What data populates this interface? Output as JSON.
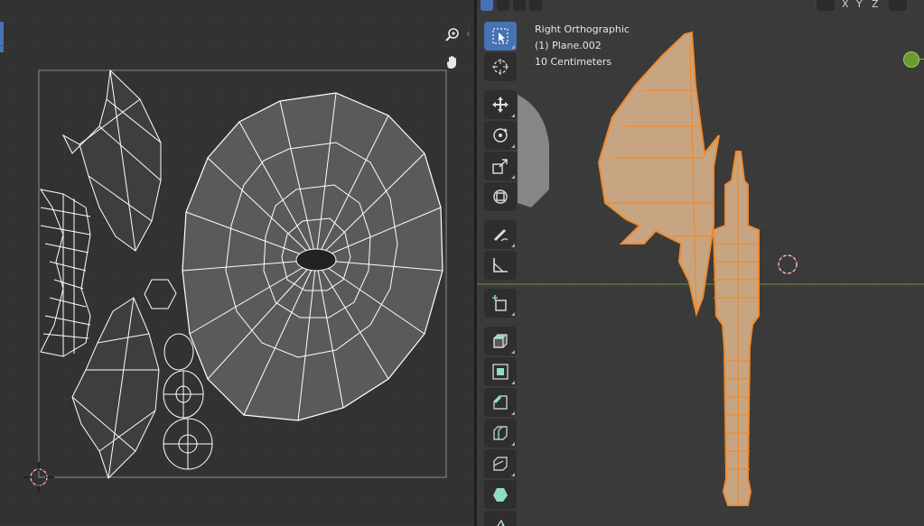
{
  "uv_editor": {
    "zoom_icon": "zoom-in-icon",
    "pan_icon": "hand-pan-icon",
    "collapse_glyph": "‹"
  },
  "viewport": {
    "view_name": "Right Orthographic",
    "object_name": "(1) Plane.002",
    "grid_scale": "10 Centimeters",
    "axis_labels": [
      "X",
      "Y",
      "Z"
    ],
    "colors": {
      "selection_orange": "#f08a2c",
      "accent_blue": "#4772b3",
      "horizon_green": "#7a9a3a"
    },
    "tools": [
      {
        "name": "select-box-tool",
        "icon": "select-box-icon",
        "active": true
      },
      {
        "name": "cursor-tool",
        "icon": "cursor-icon",
        "active": false
      },
      {
        "name": "move-tool",
        "icon": "move-icon",
        "active": false
      },
      {
        "name": "rotate-tool",
        "icon": "rotate-icon",
        "active": false
      },
      {
        "name": "scale-tool",
        "icon": "scale-icon",
        "active": false
      },
      {
        "name": "transform-tool",
        "icon": "transform-icon",
        "active": false
      },
      {
        "name": "annotate-tool",
        "icon": "annotate-icon",
        "active": false
      },
      {
        "name": "measure-tool",
        "icon": "measure-icon",
        "active": false
      },
      {
        "name": "add-cube-tool",
        "icon": "add-cube-icon",
        "active": false
      },
      {
        "name": "extrude-tool",
        "icon": "extrude-icon",
        "active": false
      },
      {
        "name": "inset-tool",
        "icon": "inset-icon",
        "active": false
      },
      {
        "name": "bevel-tool",
        "icon": "bevel-icon",
        "active": false
      },
      {
        "name": "loop-cut-tool",
        "icon": "loop-cut-icon",
        "active": false
      },
      {
        "name": "knife-tool",
        "icon": "knife-icon",
        "active": false
      },
      {
        "name": "poly-build-tool",
        "icon": "poly-build-icon",
        "active": false
      },
      {
        "name": "spin-tool",
        "icon": "spin-icon",
        "active": false
      }
    ]
  }
}
